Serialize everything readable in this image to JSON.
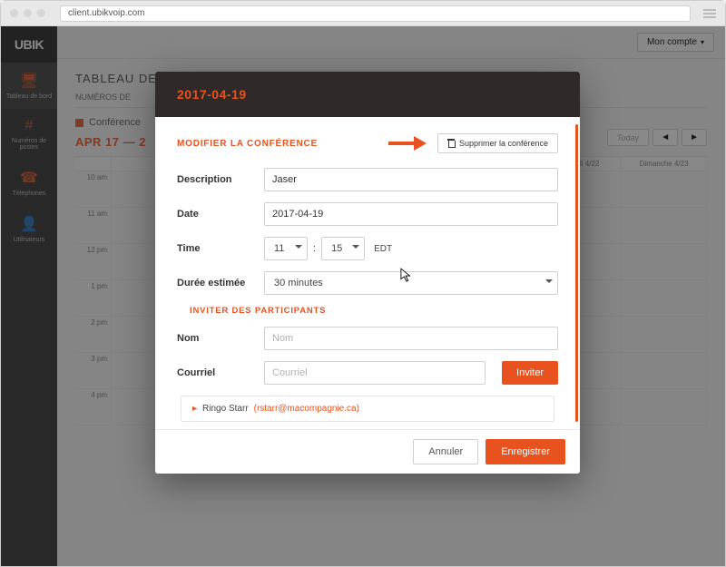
{
  "browser": {
    "url": "client.ubikvoip.com"
  },
  "brand": {
    "logo": "UBIK"
  },
  "account_menu": {
    "label": "Mon compte"
  },
  "sidebar": {
    "items": [
      {
        "label": "Tableau de bord",
        "name": "sidebar-item-dashboard",
        "icon": "monitor-icon",
        "glyph": "🖥"
      },
      {
        "label": "Numéros de postes",
        "name": "sidebar-item-extensions",
        "icon": "hash-icon",
        "glyph": "#"
      },
      {
        "label": "Téléphones",
        "name": "sidebar-item-phones",
        "icon": "phone-icon",
        "glyph": "☎"
      },
      {
        "label": "Utilisateurs",
        "name": "sidebar-item-users",
        "icon": "user-icon",
        "glyph": "👤"
      }
    ]
  },
  "dashboard": {
    "title_prefix": "TABLEAU DE",
    "tabs_prefix": "NUMÉROS DE ",
    "conference_line": "Conférence",
    "date_range": "APR 17 — 2",
    "today_label": "Today",
    "calendar": {
      "day_headers": [
        "",
        "",
        "",
        "",
        "",
        "Samedi 4/22",
        "Dimanche 4/23"
      ],
      "time_labels": [
        "10 am",
        "11 am",
        "12 pm",
        "1 pm",
        "2 pm",
        "3 pm",
        "4 pm"
      ]
    }
  },
  "modal": {
    "header_date": "2017-04-19",
    "section_title": "MODIFIER LA CONFÉRENCE",
    "delete_label": "Supprimer la conférence",
    "fields": {
      "description": {
        "label": "Description",
        "value": "Jaser"
      },
      "date": {
        "label": "Date",
        "value": "2017-04-19"
      },
      "time": {
        "label": "Time",
        "hour": "11",
        "minute": "15",
        "sep": ":",
        "tz": "EDT"
      },
      "duration": {
        "label": "Durée estimée",
        "value": "30 minutes"
      }
    },
    "invite": {
      "section_title": "INVITER DES PARTICIPANTS",
      "name": {
        "label": "Nom",
        "placeholder": "Nom"
      },
      "email": {
        "label": "Courriel",
        "placeholder": "Courriel"
      },
      "button": "Inviter"
    },
    "participant": {
      "name": "Ringo Starr",
      "email": "(rstarr@macompagnie.ca)"
    },
    "footer": {
      "cancel": "Annuler",
      "save": "Enregistrer"
    }
  }
}
